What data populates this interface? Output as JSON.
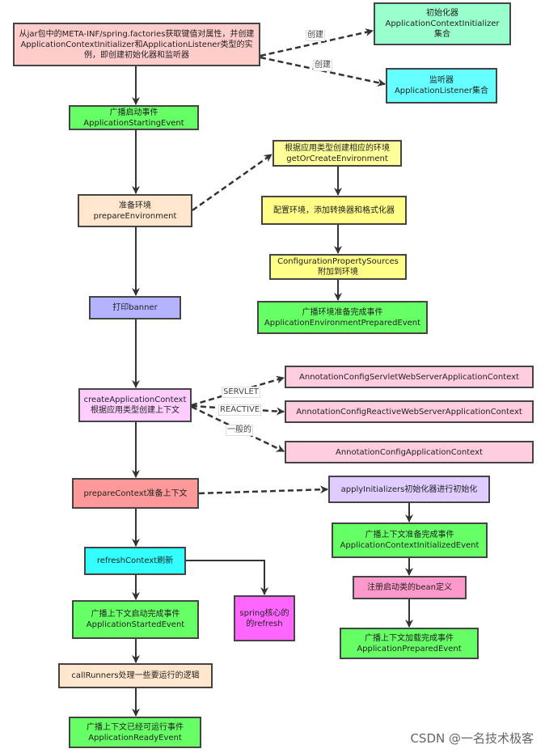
{
  "nodes": {
    "load_factories": {
      "text": "从jar包中的META-INF/spring.factories获取键值对属性，并创建ApplicationContextInitializer和ApplicationListener类型的实例，即创建初始化器和监听器",
      "color": "#ffcccc"
    },
    "initializers": {
      "text": "初始化器\nApplicationContextInitializer\n集合",
      "color": "#99ffcc"
    },
    "listeners": {
      "text": "监听器\nApplicationListener集合",
      "color": "#66ffff"
    },
    "starting_event": {
      "text": "广播启动事件\nApplicationStartingEvent",
      "color": "#66ff66"
    },
    "prepare_env": {
      "text": "准备环境\nprepareEnvironment",
      "color": "#ffe6cc"
    },
    "get_or_create_env": {
      "text": "根据应用类型创建相应的环境\ngetOrCreateEnvironment",
      "color": "#ffff99"
    },
    "configure_env": {
      "text": "配置环境，添加转换器和格式化器",
      "color": "#ffff88"
    },
    "config_property_sources": {
      "text": "ConfigurationPropertySources\n附加到环境",
      "color": "#ffff88"
    },
    "env_prepared_event": {
      "text": "广播环境准备完成事件\nApplicationEnvironmentPreparedEvent",
      "color": "#66ff66"
    },
    "print_banner": {
      "text": "打印banner",
      "color": "#b3b3ff"
    },
    "create_context": {
      "text": "createApplicationContext\n根据应用类型创建上下文",
      "color": "#ffccff"
    },
    "servlet_context": {
      "text": "AnnotationConfigServletWebServerApplicationContext",
      "color": "#ffcce0"
    },
    "reactive_context": {
      "text": "AnnotationConfigReactiveWebServerApplicationContext",
      "color": "#ffcce0"
    },
    "general_context": {
      "text": "AnnotationConfigApplicationContext",
      "color": "#ffcce0"
    },
    "prepare_context": {
      "text": "prepareContext准备上下文",
      "color": "#ff9999"
    },
    "apply_initializers": {
      "text": "applyInitializers初始化器进行初始化",
      "color": "#e0ccff"
    },
    "context_initialized_event": {
      "text": "广播上下文准备完成事件\nApplicationContextInitializedEvent",
      "color": "#66ff66"
    },
    "register_bean": {
      "text": "注册启动类的bean定义",
      "color": "#ff99cc"
    },
    "prepared_event": {
      "text": "广播上下文加载完成事件\nApplicationPreparedEvent",
      "color": "#66ff66"
    },
    "refresh_context": {
      "text": "refreshContext刷新",
      "color": "#33ffff"
    },
    "spring_refresh": {
      "text": "spring核心的\n的refresh",
      "color": "#ff66ff"
    },
    "started_event": {
      "text": "广播上下文启动完成事件\nApplicationStartedEvent",
      "color": "#66ff66"
    },
    "call_runners": {
      "text": "callRunners处理一些要运行的逻辑",
      "color": "#ffe6cc"
    },
    "ready_event": {
      "text": "广播上下文已经可运行事件\nApplicationReadyEvent",
      "color": "#66ff66"
    }
  },
  "edge_labels": {
    "create1": "创建",
    "create2": "创建",
    "servlet": "SERVLET",
    "reactive": "REACTIVE",
    "general": "一般的"
  },
  "watermark": "CSDN @一名技术极客"
}
